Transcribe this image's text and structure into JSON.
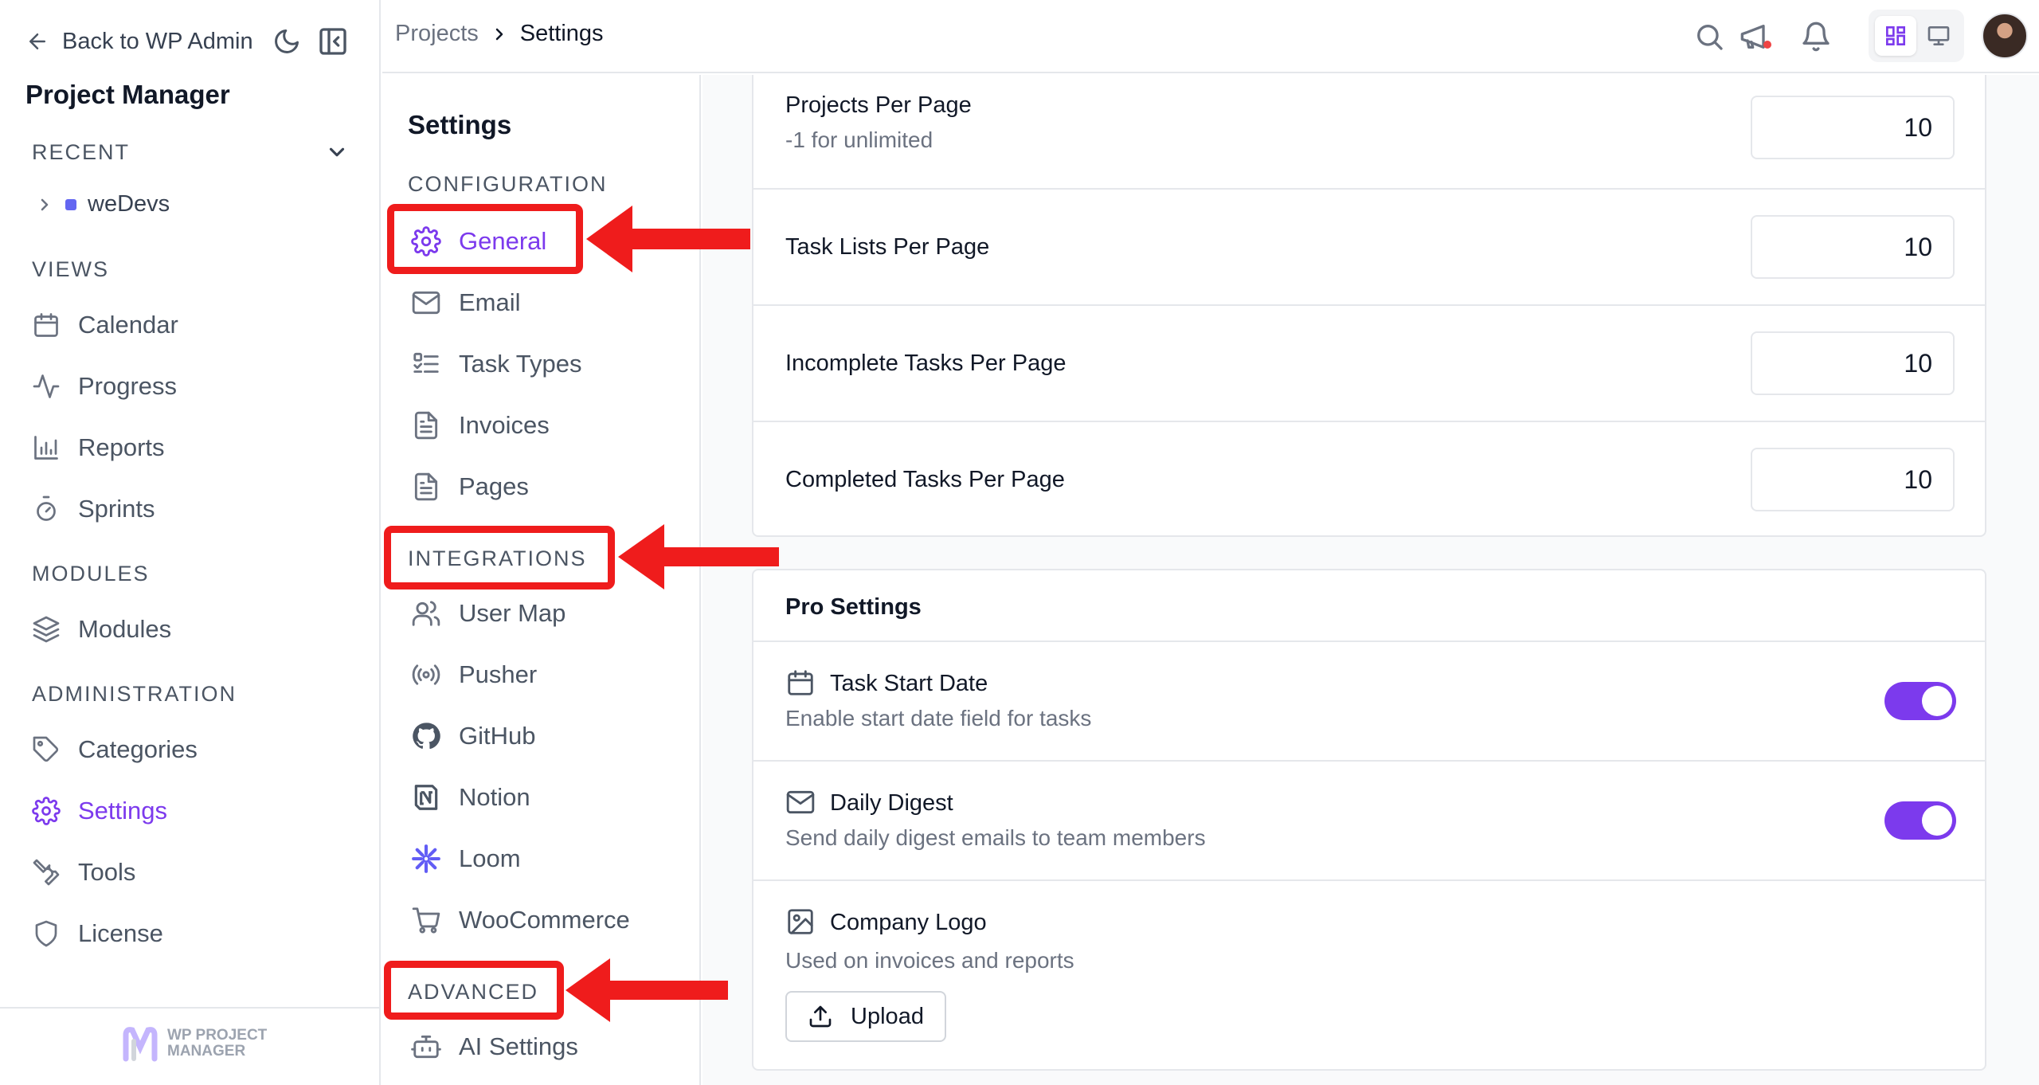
{
  "sidebar": {
    "back_label": "Back to WP Admin",
    "app_title": "Project Manager",
    "sections": {
      "recent": "RECENT",
      "views": "VIEWS",
      "modules": "MODULES",
      "administration": "ADMINISTRATION"
    },
    "recent_item": "weDevs",
    "views": [
      "Calendar",
      "Progress",
      "Reports",
      "Sprints"
    ],
    "modules": [
      "Modules"
    ],
    "admin": [
      "Categories",
      "Settings",
      "Tools",
      "License"
    ],
    "active_item": "Settings",
    "footer_logo_line1": "WP PROJECT",
    "footer_logo_line2": "MANAGER"
  },
  "header": {
    "breadcrumb_parent": "Projects",
    "breadcrumb_current": "Settings"
  },
  "subnav": {
    "title": "Settings",
    "configuration_label": "CONFIGURATION",
    "configuration": [
      "General",
      "Email",
      "Task Types",
      "Invoices",
      "Pages"
    ],
    "integrations_label": "INTEGRATIONS",
    "integrations": [
      "User Map",
      "Pusher",
      "GitHub",
      "Notion",
      "Loom",
      "WooCommerce"
    ],
    "advanced_label": "ADVANCED",
    "advanced": [
      "AI Settings"
    ],
    "active_item": "General"
  },
  "general_settings": {
    "projects_per_page": {
      "label": "Projects Per Page",
      "hint": "-1 for unlimited",
      "value": "10"
    },
    "task_lists_per_page": {
      "label": "Task Lists Per Page",
      "value": "10"
    },
    "incomplete_tasks_per_page": {
      "label": "Incomplete Tasks Per Page",
      "value": "10"
    },
    "completed_tasks_per_page": {
      "label": "Completed Tasks Per Page",
      "value": "10"
    }
  },
  "pro_settings": {
    "title": "Pro Settings",
    "task_start_date": {
      "label": "Task Start Date",
      "desc": "Enable start date field for tasks",
      "enabled": true
    },
    "daily_digest": {
      "label": "Daily Digest",
      "desc": "Send daily digest emails to team members",
      "enabled": true
    },
    "company_logo": {
      "label": "Company Logo",
      "desc": "Used on invoices and reports",
      "button": "Upload"
    }
  },
  "colors": {
    "accent": "#7c3aed",
    "annotation": "#ef1c1c",
    "border": "#e5e7eb"
  }
}
